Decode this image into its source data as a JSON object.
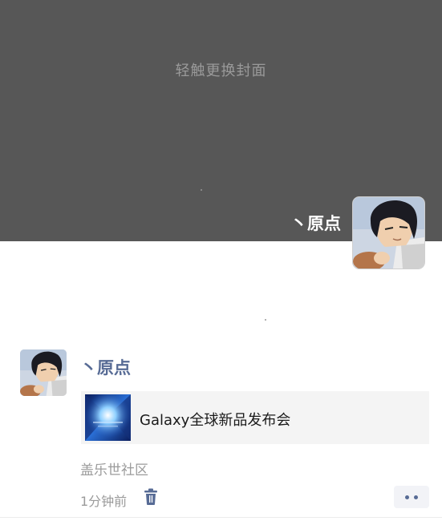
{
  "cover": {
    "hint": "轻触更换封面",
    "background": "#575757"
  },
  "profile": {
    "name": "丶原点",
    "avatar_icon": "anime-character-avatar"
  },
  "post": {
    "author": "丶原点",
    "avatar_icon": "anime-character-avatar",
    "share": {
      "title": "Galaxy全球新品发布会",
      "thumb_icon": "galaxy-event-thumbnail"
    },
    "source": "盖乐世社区",
    "time": "1分钟前",
    "delete_icon": "trash-icon",
    "more_icon": "more-dots-icon"
  },
  "colors": {
    "name_link": "#576b95",
    "meta_text": "#9b9b9b"
  }
}
